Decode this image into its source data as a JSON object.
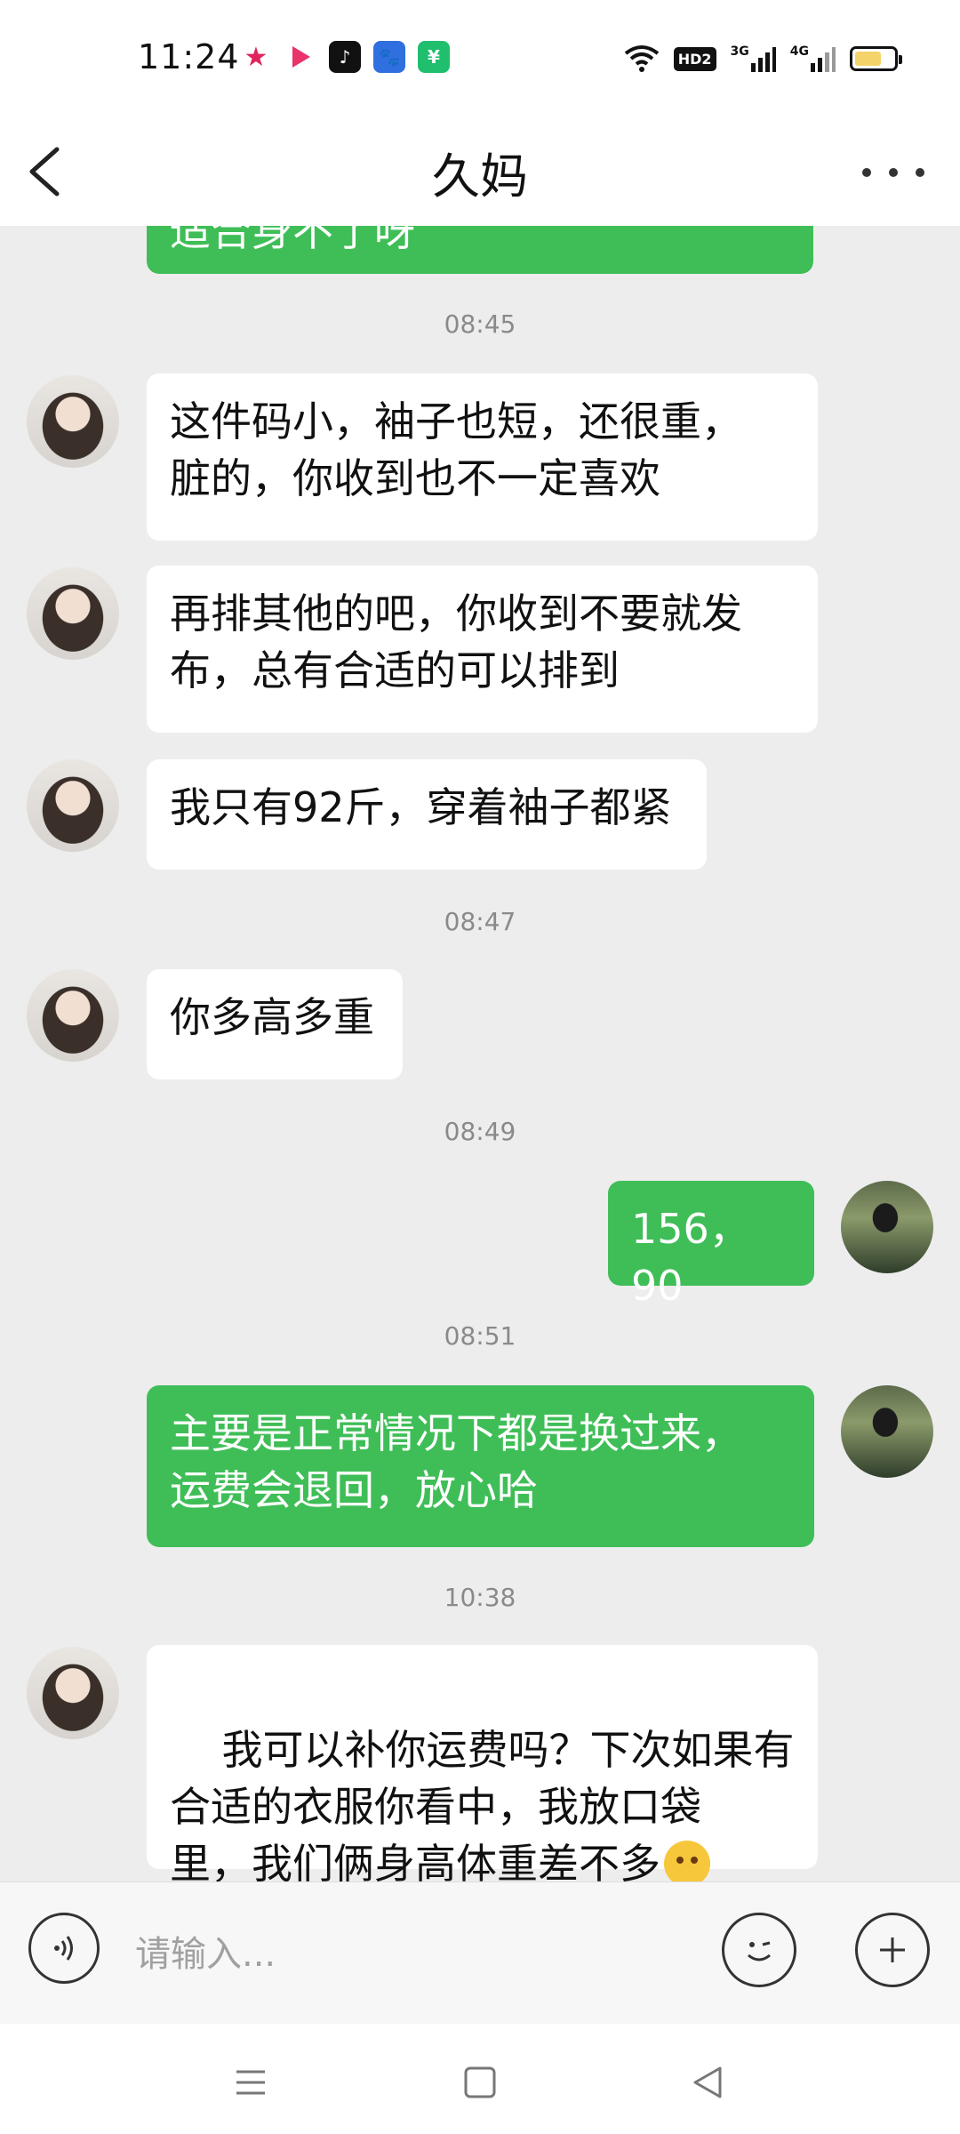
{
  "status_bar": {
    "time": "11:24",
    "app_icons": [
      "star-app-icon",
      "video-app-icon",
      "tiktok-icon",
      "baidu-icon",
      "wechat-pay-icon"
    ],
    "signal_labels": [
      "3G",
      "4G"
    ],
    "hd_label": "HD2"
  },
  "header": {
    "title": "久妈"
  },
  "messages": [
    {
      "from": "me",
      "text": "适合身不了呀"
    },
    {
      "type": "time",
      "text": "08:45"
    },
    {
      "from": "her",
      "text": "这件码小，袖子也短，还很重，\n脏的，你收到也不一定喜欢"
    },
    {
      "from": "her",
      "text": "再排其他的吧，你收到不要就发\n布，总有合适的可以排到"
    },
    {
      "from": "her",
      "text": "我只有92斤，穿着袖子都紧"
    },
    {
      "type": "time",
      "text": "08:47"
    },
    {
      "from": "her",
      "text": "你多高多重"
    },
    {
      "type": "time",
      "text": "08:49"
    },
    {
      "from": "me",
      "text": "156，90"
    },
    {
      "type": "time",
      "text": "08:51"
    },
    {
      "from": "me",
      "text": "主要是正常情况下都是换过来，\n运费会退回，放心哈"
    },
    {
      "type": "time",
      "text": "10:38"
    },
    {
      "from": "her",
      "text": "我可以补你运费吗？下次如果有\n合适的衣服你看中，我放口袋\n里，我们俩身高体重差不多"
    }
  ],
  "input": {
    "placeholder": "请输入..."
  },
  "colors": {
    "outgoing_bubble": "#3fbe57",
    "incoming_bubble": "#ffffff",
    "chat_background": "#ededed"
  }
}
